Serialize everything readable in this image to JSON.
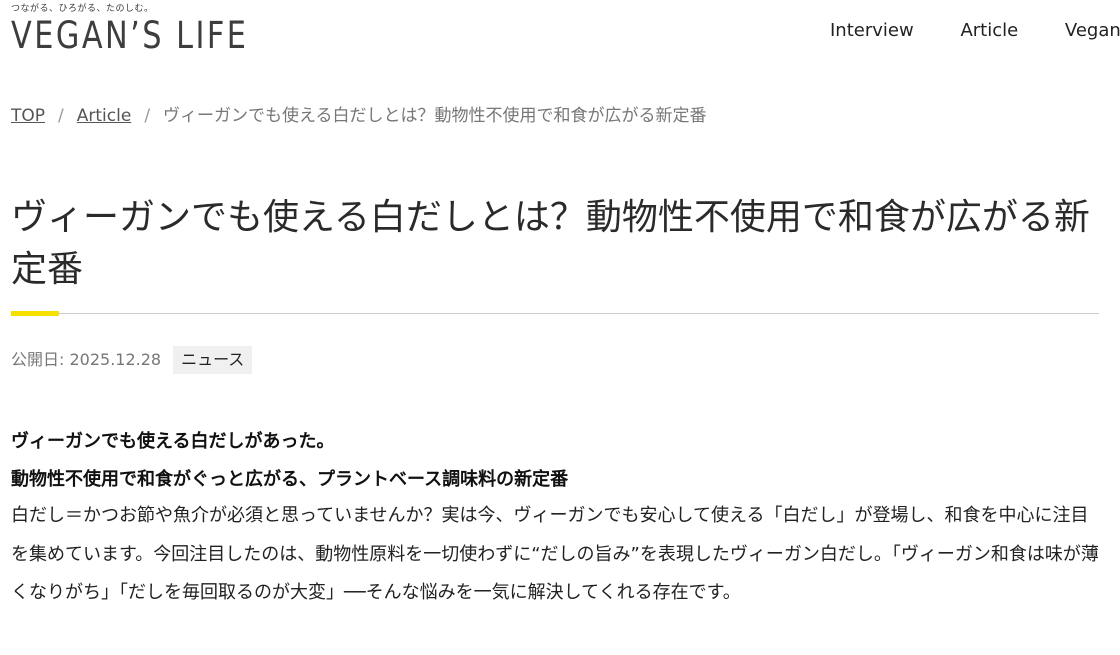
{
  "header": {
    "tagline": "つながる、ひろがる、たのしむ。",
    "logo": "VEGAN’S LIFE",
    "nav": [
      "Interview",
      "Article",
      "Vegan’"
    ]
  },
  "breadcrumb": {
    "top": "TOP",
    "article": "Article",
    "current": "ヴィーガンでも使える白だしとは？動物性不使用で和食が広がる新定番",
    "separator": "/"
  },
  "article": {
    "title": "ヴィーガンでも使える白だしとは？動物性不使用で和食が広がる新定番",
    "date": "公開日: 2025.12.28",
    "category": "ニュース",
    "lead_1": "ヴィーガンでも使える白だしがあった。",
    "lead_2": "動物性不使用で和食がぐっと広がる、プラントベース調味料の新定番",
    "body": "白だし＝かつお節や魚介が必須と思っていませんか？実は今、ヴィーガンでも安心して使える「白だし」が登場し、和食を中心に注目を集めています。今回注目したのは、動物性原料を一切使わずに“だしの旨み”を表現したヴィーガン白だし。「ヴィーガン和食は味が薄くなりがち」「だしを毎回取るのが大変」──そんな悩みを一気に解決してくれる存在です。"
  },
  "colors": {
    "accent": "#f5e000",
    "text": "#222222",
    "muted": "#777777",
    "tag_bg": "#f0f0f0"
  }
}
